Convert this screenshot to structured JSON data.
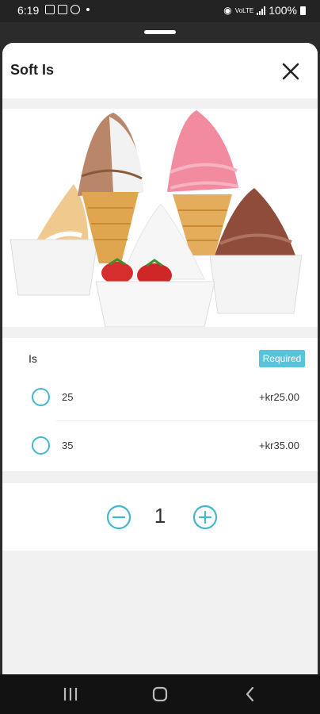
{
  "status_bar": {
    "time": "6:19",
    "battery": "100%",
    "network_label": "VoLTE"
  },
  "sheet": {
    "title": "Soft Is",
    "close_icon": "close-icon"
  },
  "product_image": {
    "subject": "assorted soft serve ice cream in cones and cups"
  },
  "option_group": {
    "title": "Is",
    "badge": "Required",
    "options": [
      {
        "label": "25",
        "price": "+kr25.00"
      },
      {
        "label": "35",
        "price": "+kr35.00"
      }
    ]
  },
  "quantity": {
    "value": "1",
    "decrement_icon": "minus-circle-icon",
    "increment_icon": "plus-circle-icon"
  },
  "nav_bar": {
    "icons": [
      "recents-icon",
      "home-icon",
      "back-icon"
    ]
  },
  "colors": {
    "accent": "#45b6cf",
    "badge": "#58c4da"
  }
}
